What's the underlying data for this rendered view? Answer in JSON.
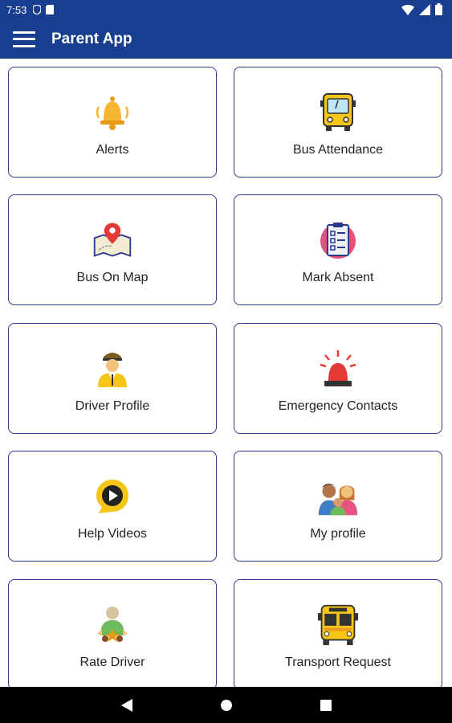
{
  "status_bar": {
    "time": "7:53"
  },
  "app_bar": {
    "title": "Parent App"
  },
  "tiles": [
    {
      "label": "Alerts",
      "icon": "bell-icon"
    },
    {
      "label": "Bus Attendance",
      "icon": "bus-front-icon"
    },
    {
      "label": "Bus On Map",
      "icon": "map-pin-icon"
    },
    {
      "label": "Mark Absent",
      "icon": "checklist-icon"
    },
    {
      "label": "Driver Profile",
      "icon": "driver-icon"
    },
    {
      "label": "Emergency Contacts",
      "icon": "siren-icon"
    },
    {
      "label": "Help Videos",
      "icon": "play-circle-icon"
    },
    {
      "label": "My profile",
      "icon": "family-icon"
    },
    {
      "label": "Rate Driver",
      "icon": "rate-driver-icon"
    },
    {
      "label": "Transport Request",
      "icon": "school-bus-icon"
    }
  ],
  "colors": {
    "app_bar": "#1a3e8f",
    "card_border": "#2b3a8a",
    "nav_bar": "#000000"
  }
}
